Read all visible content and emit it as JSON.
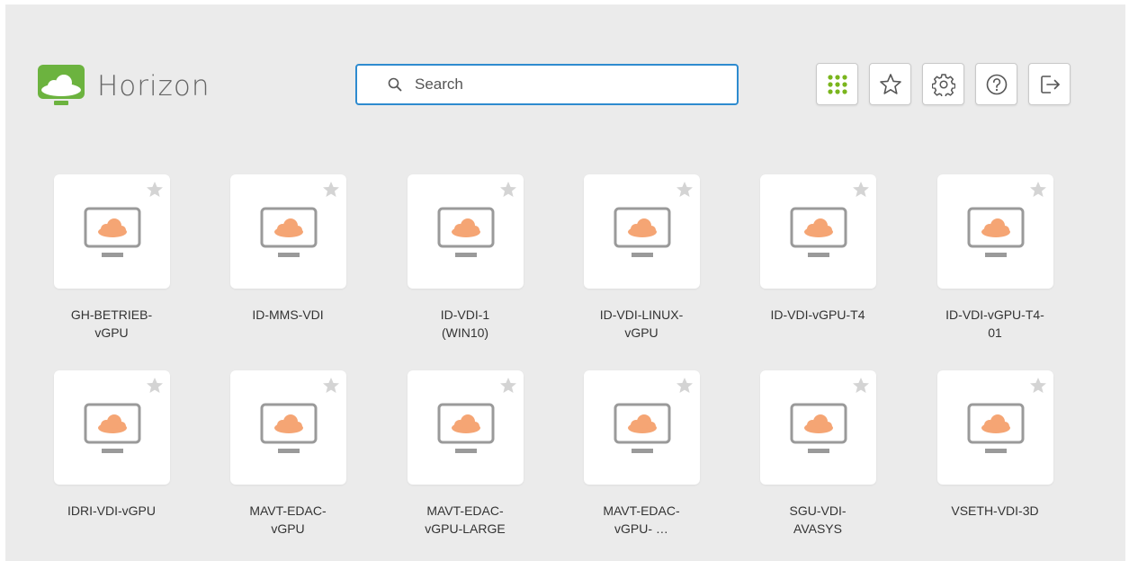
{
  "brand": {
    "name": "Horizon",
    "accent": "#6cb33f"
  },
  "search": {
    "placeholder": "Search",
    "value": "",
    "border_color": "#2e8bcf"
  },
  "toolbar": [
    {
      "name": "apps-grid-icon",
      "tooltip": ""
    },
    {
      "name": "star-icon"
    },
    {
      "name": "gear-icon"
    },
    {
      "name": "help-icon"
    },
    {
      "name": "logout-icon"
    }
  ],
  "desktops": [
    {
      "label": "GH-BETRIEB-vGPU"
    },
    {
      "label": "ID-MMS-VDI"
    },
    {
      "label": "ID-VDI-1 (WIN10)"
    },
    {
      "label": "ID-VDI-LINUX-vGPU"
    },
    {
      "label": "ID-VDI-vGPU-T4"
    },
    {
      "label": "ID-VDI-vGPU-T4-01"
    },
    {
      "label": "IDRI-VDI-vGPU"
    },
    {
      "label": "MAVT-EDAC-vGPU"
    },
    {
      "label": "MAVT-EDAC-vGPU-LARGE"
    },
    {
      "label": "MAVT-EDAC-vGPU- …"
    },
    {
      "label": "SGU-VDI-AVASYS"
    },
    {
      "label": "VSETH-VDI-3D"
    }
  ],
  "colors": {
    "cloud": "#f5a574",
    "monitor": "#9a9a9a",
    "fav_star": "#d4d4d4",
    "apps_icon": "#7ab51d"
  }
}
